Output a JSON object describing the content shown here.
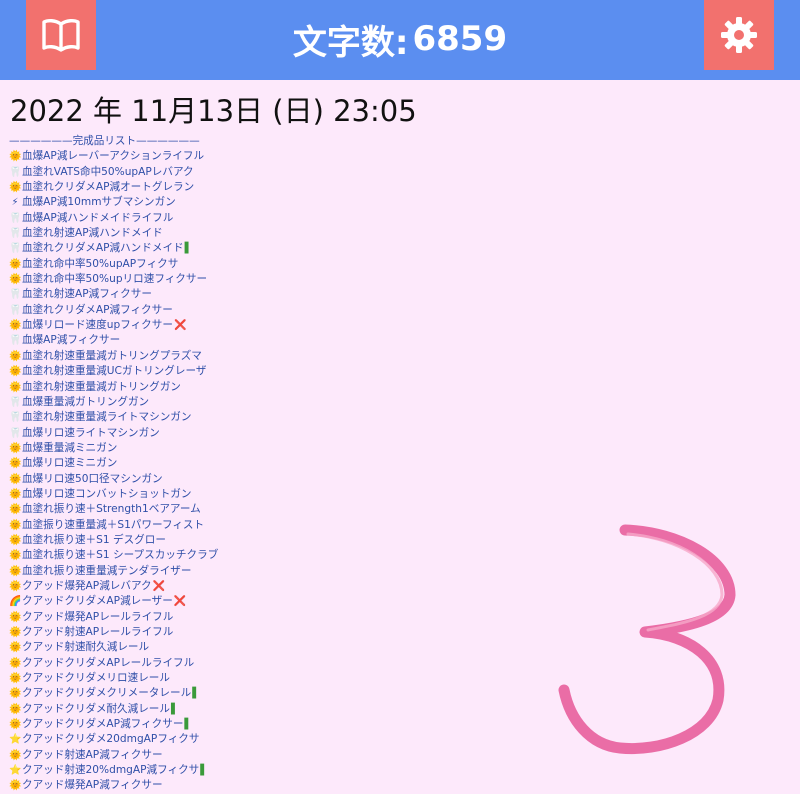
{
  "header": {
    "book_icon": "book-icon",
    "settings_icon": "gear-icon",
    "title_label": "文字数:",
    "char_count": "6859"
  },
  "date_line": "2022 年 11月13日 (日) 23:05",
  "list": {
    "header": "——————完成品リスト——————",
    "items": [
      {
        "emoji": "🌞",
        "text": "血爆AP減レーバーアクションライフル",
        "mark": ""
      },
      {
        "emoji": "🦷",
        "text": "血塗れVATS命中50%upAPレバアク",
        "mark": ""
      },
      {
        "emoji": "🌞",
        "text": "血塗れクリダメAP減オートグレラン",
        "mark": ""
      },
      {
        "emoji": "⚡",
        "text": "血爆AP減10mmサブマシンガン",
        "mark": ""
      },
      {
        "emoji": "🦷",
        "text": "血爆AP減ハンドメイドライフル",
        "mark": ""
      },
      {
        "emoji": "🦷",
        "text": "血塗れ射速AP減ハンドメイド",
        "mark": ""
      },
      {
        "emoji": "🦷",
        "text": "血塗れクリダメAP減ハンドメイド",
        "mark": "▌"
      },
      {
        "emoji": "🌞",
        "text": "血塗れ命中率50%upAPフィクサ",
        "mark": ""
      },
      {
        "emoji": "🌞",
        "text": "血塗れ命中率50%upリロ速フィクサー",
        "mark": ""
      },
      {
        "emoji": "🦷",
        "text": "血塗れ射速AP減フィクサー",
        "mark": ""
      },
      {
        "emoji": "🦷",
        "text": "血塗れクリダメAP減フィクサー",
        "mark": ""
      },
      {
        "emoji": "🌞",
        "text": "血爆リロード速度upフィクサー",
        "mark": "❌"
      },
      {
        "emoji": "🦷",
        "text": "血爆AP減フィクサー",
        "mark": ""
      },
      {
        "emoji": "🌞",
        "text": "血塗れ射速重量減ガトリングプラズマ",
        "mark": ""
      },
      {
        "emoji": "🌞",
        "text": "血塗れ射速重量減UCガトリングレーザ",
        "mark": ""
      },
      {
        "emoji": "🌞",
        "text": "血塗れ射速重量減ガトリングガン",
        "mark": ""
      },
      {
        "emoji": "🦷",
        "text": "血爆重量減ガトリングガン",
        "mark": ""
      },
      {
        "emoji": "🦷",
        "text": "血塗れ射速重量減ライトマシンガン",
        "mark": ""
      },
      {
        "emoji": "🦷",
        "text": "血爆リロ速ライトマシンガン",
        "mark": ""
      },
      {
        "emoji": "🌞",
        "text": "血爆重量減ミニガン",
        "mark": ""
      },
      {
        "emoji": "🌞",
        "text": "血爆リロ速ミニガン",
        "mark": ""
      },
      {
        "emoji": "🌞",
        "text": "血爆リロ速50口径マシンガン",
        "mark": ""
      },
      {
        "emoji": "🌞",
        "text": "血爆リロ速コンバットショットガン",
        "mark": ""
      },
      {
        "emoji": "🌞",
        "text": "血塗れ振り速＋Strength1ベアアーム",
        "mark": ""
      },
      {
        "emoji": "🌞",
        "text": "血塗振り速重量減＋S1パワーフィスト",
        "mark": ""
      },
      {
        "emoji": "🌞",
        "text": "血塗れ振り速＋S1 デスグロー",
        "mark": ""
      },
      {
        "emoji": "🌞",
        "text": "血塗れ振り速＋S1 シープスカッチクラブ",
        "mark": ""
      },
      {
        "emoji": "🌞",
        "text": "血塗れ振り速重量減テンダライザー",
        "mark": ""
      },
      {
        "emoji": "🌞",
        "text": "クアッド爆発AP減レバアク",
        "mark": "❌"
      },
      {
        "emoji": "🌈",
        "text": "クアッドクリダメAP減レーザー",
        "mark": "❌"
      },
      {
        "emoji": "🌞",
        "text": "クアッド爆発APレールライフル",
        "mark": ""
      },
      {
        "emoji": "🌞",
        "text": "クアッド射速APレールライフル",
        "mark": ""
      },
      {
        "emoji": "🌞",
        "text": "クアッド射速耐久減レール",
        "mark": ""
      },
      {
        "emoji": "🌞",
        "text": "クアッドクリダメAPレールライフル",
        "mark": ""
      },
      {
        "emoji": "🌞",
        "text": "クアッドクリダメリロ速レール",
        "mark": ""
      },
      {
        "emoji": "🌞",
        "text": "クアッドクリダメクリメータレール",
        "mark": "▌"
      },
      {
        "emoji": "🌞",
        "text": "クアッドクリダメ耐久減レール",
        "mark": "▌"
      },
      {
        "emoji": "🌞",
        "text": "クアッドクリダメAP減フィクサー",
        "mark": "▌"
      },
      {
        "emoji": "⭐",
        "text": "クアッドクリダメ20dmgAPフィクサ",
        "mark": ""
      },
      {
        "emoji": "🌞",
        "text": "クアッド射速AP減フィクサー",
        "mark": ""
      },
      {
        "emoji": "⭐",
        "text": "クアッド射速20%dmgAP減フィクサ",
        "mark": "▌"
      },
      {
        "emoji": "🌞",
        "text": "クアッド爆発AP減フィクサー",
        "mark": ""
      }
    ]
  },
  "doodle": {
    "name": "handwritten-3-doodle",
    "color": "#e8629e"
  },
  "colors": {
    "header_bg": "#5b8ef0",
    "button_bg": "#f2716e",
    "page_bg": "#fde9fb",
    "list_text": "#2f4fa8"
  }
}
